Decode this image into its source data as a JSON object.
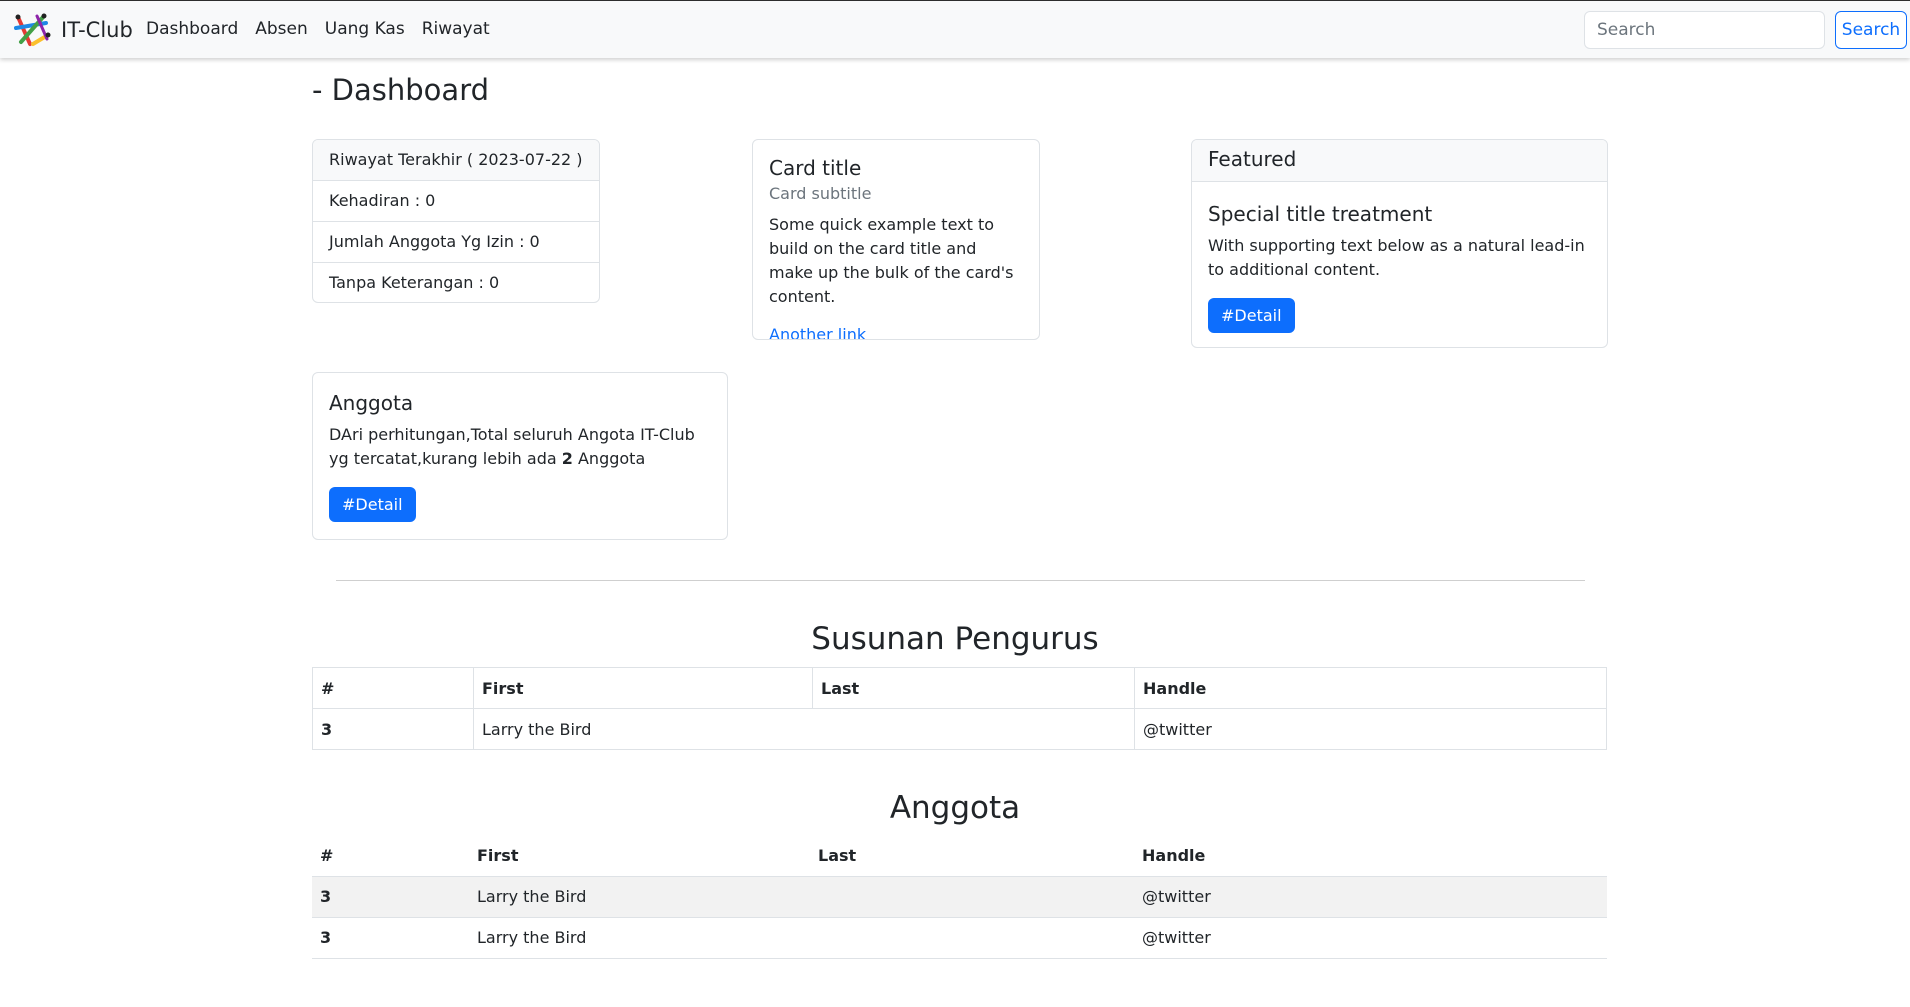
{
  "navbar": {
    "brand": "IT-Club",
    "links": [
      "Dashboard",
      "Absen",
      "Uang Kas",
      "Riwayat"
    ],
    "search_placeholder": "Search",
    "search_button": "Search"
  },
  "page_title": "- Dashboard",
  "riwayat_card": {
    "header": "Riwayat Terakhir ( 2023-07-22 )",
    "items": [
      "Kehadiran : 0",
      "Jumlah Anggota Yg Izin : 0",
      "Tanpa Keterangan : 0"
    ]
  },
  "example_card": {
    "title": "Card title",
    "subtitle": "Card subtitle",
    "text": "Some quick example text to build on the card title and make up the bulk of the card's content.",
    "link": "Another link"
  },
  "featured_card": {
    "header": "Featured",
    "title": "Special title treatment",
    "text": "With supporting text below as a natural lead-in to additional content.",
    "button": "#Detail"
  },
  "anggota_card": {
    "title": "Anggota",
    "text_before": "DAri perhitungan,Total seluruh Angota IT-Club yg tercatat,kurang lebih ada ",
    "count": "2",
    "text_after": " Anggota",
    "button": "#Detail"
  },
  "pengurus": {
    "title": "Susunan Pengurus",
    "headers": [
      "#",
      "First",
      "Last",
      "Handle"
    ],
    "rows": [
      {
        "num": "3",
        "name": "Larry the Bird",
        "handle": "@twitter"
      }
    ]
  },
  "anggota_table": {
    "title": "Anggota",
    "headers": [
      "#",
      "First",
      "Last",
      "Handle"
    ],
    "rows": [
      {
        "num": "3",
        "first": "Larry the Bird",
        "last": "",
        "handle": "@twitter"
      },
      {
        "num": "3",
        "first": "Larry the Bird",
        "last": "",
        "handle": "@twitter"
      }
    ]
  }
}
